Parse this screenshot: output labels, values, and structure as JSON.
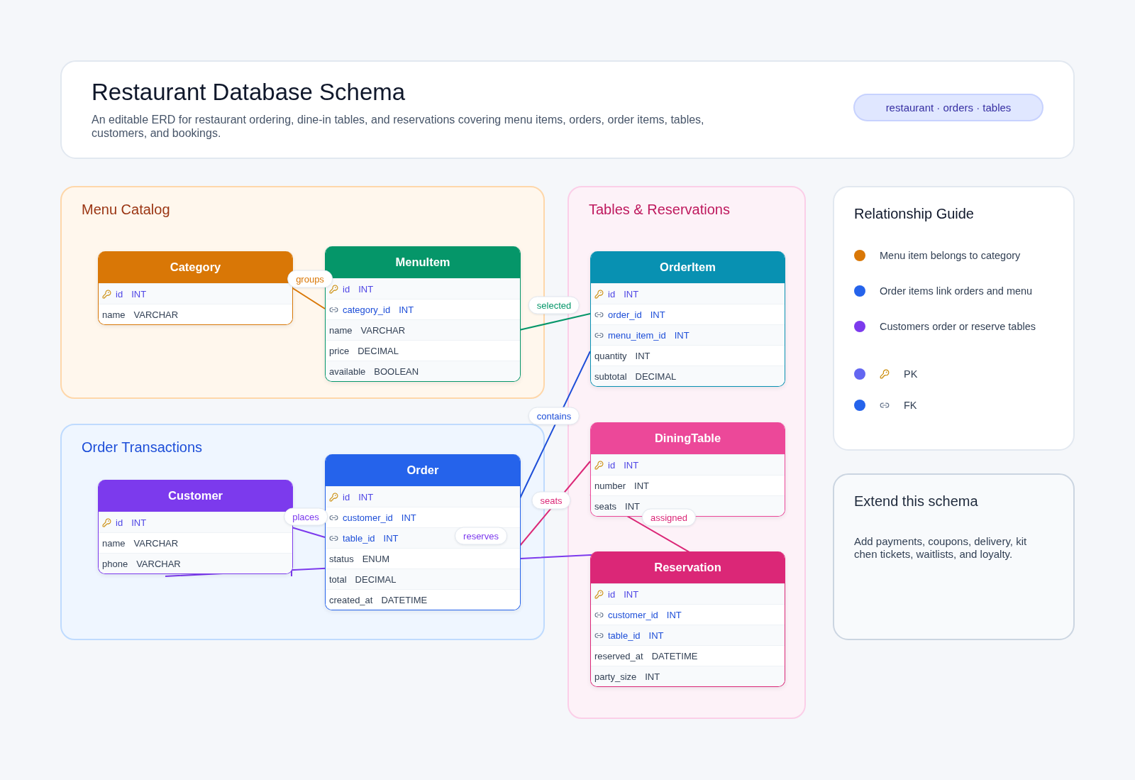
{
  "header": {
    "title": "Restaurant Database Schema",
    "description": "An editable ERD for restaurant ordering, dine-in tables, and reservations covering menu items, orders, order items, tables, customers, and bookings.",
    "tag": "restaurant · orders · tables"
  },
  "groups": [
    {
      "title": "Menu Catalog",
      "color": "#9a3412"
    },
    {
      "title": "Order Transactions",
      "color": "#1d4ed8"
    },
    {
      "title": "Tables & Reservations",
      "color": "#be185d"
    }
  ],
  "tables": [
    {
      "name": "Category",
      "color": "#d97706",
      "rows": [
        {
          "name": "id",
          "type": "INT",
          "kind": "pk"
        },
        {
          "name": "name",
          "type": "VARCHAR",
          "kind": "plain"
        }
      ]
    },
    {
      "name": "MenuItem",
      "color": "#059669",
      "rows": [
        {
          "name": "id",
          "type": "INT",
          "kind": "pk"
        },
        {
          "name": "category_id",
          "type": "INT",
          "kind": "fk"
        },
        {
          "name": "name",
          "type": "VARCHAR",
          "kind": "plain"
        },
        {
          "name": "price",
          "type": "DECIMAL",
          "kind": "plain"
        },
        {
          "name": "available",
          "type": "BOOLEAN",
          "kind": "plain"
        }
      ]
    },
    {
      "name": "Customer",
      "color": "#7c3aed",
      "rows": [
        {
          "name": "id",
          "type": "INT",
          "kind": "pk"
        },
        {
          "name": "name",
          "type": "VARCHAR",
          "kind": "plain"
        },
        {
          "name": "phone",
          "type": "VARCHAR",
          "kind": "plain"
        }
      ]
    },
    {
      "name": "Order",
      "color": "#2563eb",
      "rows": [
        {
          "name": "id",
          "type": "INT",
          "kind": "pk"
        },
        {
          "name": "customer_id",
          "type": "INT",
          "kind": "fk"
        },
        {
          "name": "table_id",
          "type": "INT",
          "kind": "fk"
        },
        {
          "name": "status",
          "type": "ENUM",
          "kind": "plain"
        },
        {
          "name": "total",
          "type": "DECIMAL",
          "kind": "plain"
        },
        {
          "name": "created_at",
          "type": "DATETIME",
          "kind": "plain"
        }
      ]
    },
    {
      "name": "OrderItem",
      "color": "#0891b2",
      "rows": [
        {
          "name": "id",
          "type": "INT",
          "kind": "pk"
        },
        {
          "name": "order_id",
          "type": "INT",
          "kind": "fk"
        },
        {
          "name": "menu_item_id",
          "type": "INT",
          "kind": "fk"
        },
        {
          "name": "quantity",
          "type": "INT",
          "kind": "plain"
        },
        {
          "name": "subtotal",
          "type": "DECIMAL",
          "kind": "plain"
        }
      ]
    },
    {
      "name": "DiningTable",
      "color": "#ec4899",
      "rows": [
        {
          "name": "id",
          "type": "INT",
          "kind": "pk"
        },
        {
          "name": "number",
          "type": "INT",
          "kind": "plain"
        },
        {
          "name": "seats",
          "type": "INT",
          "kind": "plain"
        }
      ]
    },
    {
      "name": "Reservation",
      "color": "#db2777",
      "rows": [
        {
          "name": "id",
          "type": "INT",
          "kind": "pk"
        },
        {
          "name": "customer_id",
          "type": "INT",
          "kind": "fk"
        },
        {
          "name": "table_id",
          "type": "INT",
          "kind": "fk"
        },
        {
          "name": "reserved_at",
          "type": "DATETIME",
          "kind": "plain"
        },
        {
          "name": "party_size",
          "type": "INT",
          "kind": "plain"
        }
      ]
    }
  ],
  "relations": [
    {
      "label": "groups",
      "color": "#d97706"
    },
    {
      "label": "selected",
      "color": "#059669"
    },
    {
      "label": "contains",
      "color": "#1d4ed8"
    },
    {
      "label": "seats",
      "color": "#db2777"
    },
    {
      "label": "places",
      "color": "#7c3aed"
    },
    {
      "label": "reserves",
      "color": "#7c3aed"
    },
    {
      "label": "assigned",
      "color": "#db2777"
    }
  ],
  "guide": {
    "title": "Relationship Guide",
    "items": [
      {
        "text": "Menu item belongs to category",
        "color": "#d97706",
        "kind": "relation"
      },
      {
        "text": "Order items link orders and menu",
        "color": "#2563eb",
        "kind": "relation"
      },
      {
        "text": "Customers order or reserve tables",
        "color": "#7c3aed",
        "kind": "relation"
      },
      {
        "text": "PK",
        "color": "#6366f1",
        "kind": "pk"
      },
      {
        "text": "FK",
        "color": "#2563eb",
        "kind": "fk"
      }
    ]
  },
  "extend": {
    "title": "Extend this schema",
    "text": "Add payments, coupons, delivery, kit chen tickets, waitlists, and loyalty."
  }
}
